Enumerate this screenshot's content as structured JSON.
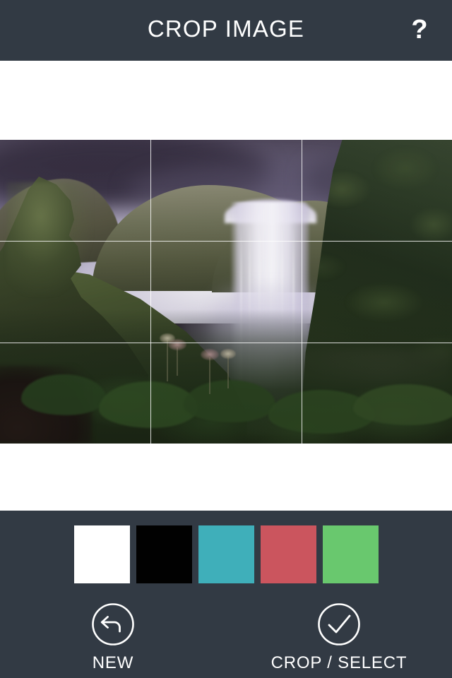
{
  "header": {
    "title": "CROP IMAGE",
    "help_icon": "question-mark-icon",
    "help_label": "?",
    "background_color": "#323A44",
    "text_color": "#FFFFFF"
  },
  "canvas": {
    "background_color": "#FFFFFF",
    "image": {
      "alt": "Skogafoss waterfall with mossy green cliffs and purple stormy sky",
      "crop_grid": "rule-of-thirds",
      "grid_line_color": "#FFFFFF",
      "grid_columns": 3,
      "grid_rows": 3
    }
  },
  "toolbar": {
    "background_color": "#323A44",
    "swatches": [
      {
        "name": "white",
        "color": "#FFFFFF",
        "selected": false
      },
      {
        "name": "black",
        "color": "#010101",
        "selected": false
      },
      {
        "name": "teal",
        "color": "#3FAFBA",
        "selected": false
      },
      {
        "name": "red",
        "color": "#CB555E",
        "selected": false
      },
      {
        "name": "green",
        "color": "#69C86E",
        "selected": false
      }
    ],
    "actions": [
      {
        "id": "new",
        "label": "NEW",
        "icon": "back-arrow-circle-icon"
      },
      {
        "id": "crop-select",
        "label": "CROP / SELECT",
        "icon": "checkmark-circle-icon"
      }
    ]
  }
}
